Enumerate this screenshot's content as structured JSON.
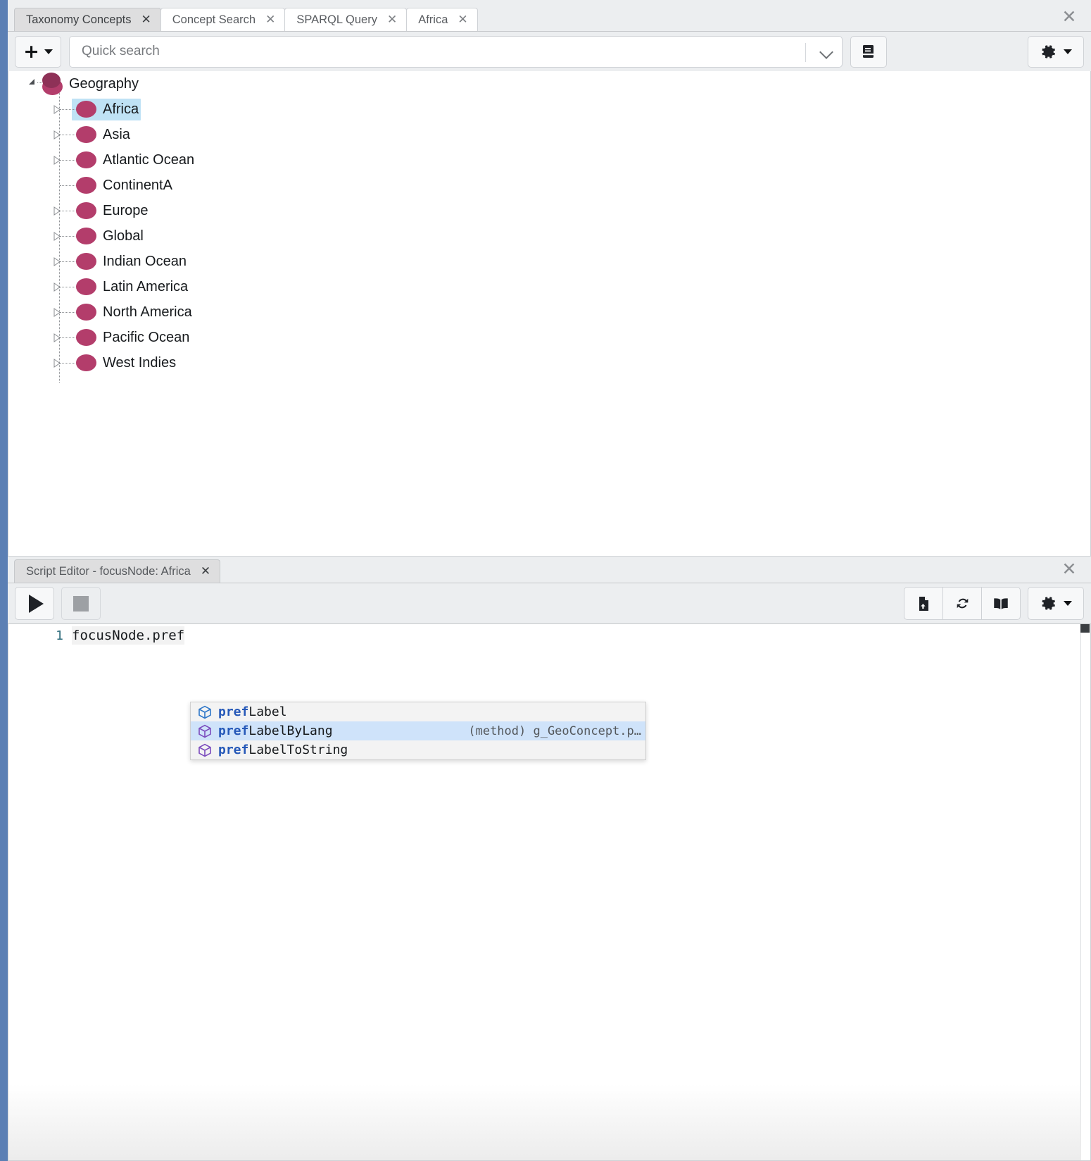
{
  "window": {
    "close_label": "✕"
  },
  "colors": {
    "accent_node": "#b33d6b",
    "accent_node_dark": "#8e3157",
    "selection": "#bfe2f5",
    "ac_selection": "#cfe3fa",
    "keyword_blue": "#2558b8",
    "rail_blue": "#5b7fb4"
  },
  "tabs": [
    {
      "label": "Taxonomy Concepts",
      "close": "✕",
      "active": true
    },
    {
      "label": "Concept Search",
      "close": "✕",
      "active": false
    },
    {
      "label": "SPARQL Query",
      "close": "✕",
      "active": false
    },
    {
      "label": "Africa",
      "close": "✕",
      "active": false
    }
  ],
  "toolbar": {
    "add_label": "+",
    "search_placeholder": "Quick search",
    "search_value": "",
    "book_icon": "book-icon",
    "gear_icon": "gear-icon",
    "dropdown_icon": "chevron-down-icon"
  },
  "tree": {
    "root": {
      "label": "Geography",
      "expanded": true
    },
    "items": [
      {
        "label": "Africa",
        "selected": true,
        "expandable": true
      },
      {
        "label": "Asia",
        "selected": false,
        "expandable": true
      },
      {
        "label": "Atlantic Ocean",
        "selected": false,
        "expandable": true
      },
      {
        "label": "ContinentA",
        "selected": false,
        "expandable": false
      },
      {
        "label": "Europe",
        "selected": false,
        "expandable": true
      },
      {
        "label": "Global",
        "selected": false,
        "expandable": true
      },
      {
        "label": "Indian Ocean",
        "selected": false,
        "expandable": true
      },
      {
        "label": "Latin America",
        "selected": false,
        "expandable": true
      },
      {
        "label": "North America",
        "selected": false,
        "expandable": true
      },
      {
        "label": "Pacific Ocean",
        "selected": false,
        "expandable": true
      },
      {
        "label": "West Indies",
        "selected": false,
        "expandable": true
      }
    ]
  },
  "script_editor": {
    "tab_label": "Script Editor - focusNode: Africa",
    "tab_close": "✕",
    "panel_close": "✕",
    "run_label": "run-button",
    "stop_label": "stop-button",
    "save_icon": "file-upload-icon",
    "refresh_icon": "refresh-icon",
    "book_icon": "book-icon",
    "gear_icon": "gear-icon",
    "code": {
      "line_number": "1",
      "text": "focusNode.pref"
    },
    "autocomplete": [
      {
        "prefix": "pref",
        "rest": "Label",
        "detail": "",
        "selected": false,
        "icon": "cube-icon-blue"
      },
      {
        "prefix": "pref",
        "rest": "LabelByLang",
        "detail": "(method) g_GeoConcept.p…",
        "selected": true,
        "icon": "cube-icon-purple"
      },
      {
        "prefix": "pref",
        "rest": "LabelToString",
        "detail": "",
        "selected": false,
        "icon": "cube-icon-purple"
      }
    ]
  }
}
